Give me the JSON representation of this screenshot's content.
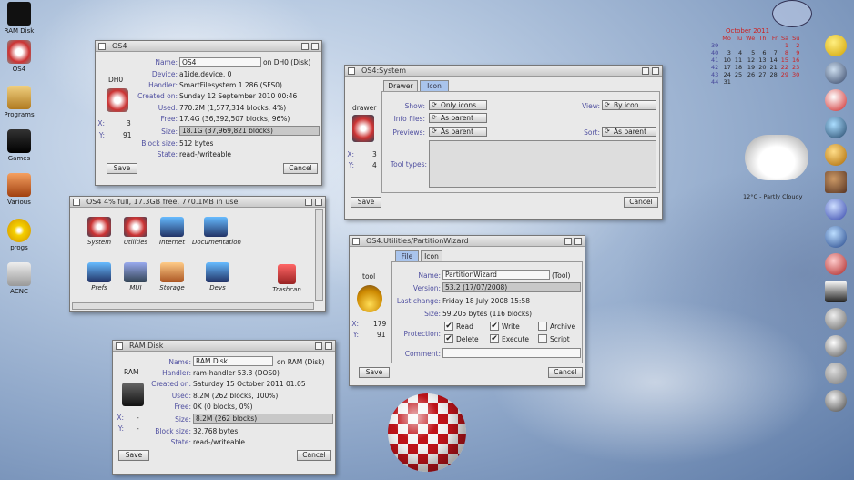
{
  "desktop_icons": [
    {
      "label": "RAM Disk"
    },
    {
      "label": "OS4"
    },
    {
      "label": "Programs"
    },
    {
      "label": "Games"
    },
    {
      "label": "Various"
    },
    {
      "label": "progs"
    },
    {
      "label": "ACNC"
    }
  ],
  "calendar": {
    "title": "October 2011",
    "days": [
      "Mo",
      "Tu",
      "We",
      "Th",
      "Fr",
      "Sa",
      "Su"
    ],
    "weeks": [
      [
        "39",
        "",
        "",
        "",
        "",
        "",
        "1",
        "2"
      ],
      [
        "40",
        "3",
        "4",
        "5",
        "6",
        "7",
        "8",
        "9"
      ],
      [
        "41",
        "10",
        "11",
        "12",
        "13",
        "14",
        "15",
        "16"
      ],
      [
        "42",
        "17",
        "18",
        "19",
        "20",
        "21",
        "22",
        "23"
      ],
      [
        "43",
        "24",
        "25",
        "26",
        "27",
        "28",
        "29",
        "30"
      ],
      [
        "44",
        "31",
        "",
        "",
        "",
        "",
        "",
        ""
      ]
    ]
  },
  "weather": {
    "text": "12°C - Partly Cloudy"
  },
  "win_os4": {
    "title": "OS4",
    "icon_label": "DH0",
    "name_label": "Name:",
    "name_value": "OS4",
    "name_suffix": "on DH0 (Disk)",
    "device_label": "Device:",
    "device_value": "a1ide.device, 0",
    "handler_label": "Handler:",
    "handler_value": "SmartFilesystem 1.286  (SFS0)",
    "created_label": "Created on:",
    "created_value": "Sunday 12 September 2010 00:46",
    "used_label": "Used:",
    "used_value": "770.2M (1,577,314 blocks, 4%)",
    "free_label": "Free:",
    "free_value": "17.4G (36,392,507 blocks, 96%)",
    "size_label": "Size:",
    "size_value": "18.1G (37,969,821 blocks)",
    "blocksize_label": "Block size:",
    "blocksize_value": "512 bytes",
    "state_label": "State:",
    "state_value": "read-/writeable",
    "x_label": "X:",
    "x_value": "3",
    "y_label": "Y:",
    "y_value": "91",
    "save": "Save",
    "cancel": "Cancel"
  },
  "win_drawer": {
    "title": "OS4  4% full, 17.3GB free, 770.1MB in use",
    "icons": [
      {
        "label": "System"
      },
      {
        "label": "Utilities"
      },
      {
        "label": "Internet"
      },
      {
        "label": "Documentation"
      },
      {
        "label": "Prefs"
      },
      {
        "label": "MUI"
      },
      {
        "label": "Storage"
      },
      {
        "label": "Devs"
      },
      {
        "label": "Trashcan"
      }
    ]
  },
  "win_system": {
    "title": "OS4:System",
    "tab_drawer": "Drawer",
    "tab_icon": "Icon",
    "icon_label": "drawer",
    "show_label": "Show:",
    "show_value": "Only icons",
    "view_label": "View:",
    "view_value": "By icon",
    "infofiles_label": "Info files:",
    "infofiles_value": "As parent",
    "previews_label": "Previews:",
    "previews_value": "As parent",
    "sort_label": "Sort:",
    "sort_value": "As parent",
    "tooltypes_label": "Tool types:",
    "x_label": "X:",
    "x_value": "3",
    "y_label": "Y:",
    "y_value": "4",
    "save": "Save",
    "cancel": "Cancel"
  },
  "win_pw": {
    "title": "OS4:Utilities/PartitionWizard",
    "tab_file": "File",
    "tab_icon": "Icon",
    "icon_label": "tool",
    "name_label": "Name:",
    "name_value": "PartitionWizard",
    "name_suffix": "(Tool)",
    "version_label": "Version:",
    "version_value": "53.2 (17/07/2008)",
    "change_label": "Last change:",
    "change_value": "Friday 18 July 2008 15:58",
    "size_label": "Size:",
    "size_value": "59,205 bytes (116 blocks)",
    "protection_label": "Protection:",
    "read": "Read",
    "write": "Write",
    "archive": "Archive",
    "delete": "Delete",
    "execute": "Execute",
    "script": "Script",
    "comment_label": "Comment:",
    "x_label": "X:",
    "x_value": "179",
    "y_label": "Y:",
    "y_value": "91",
    "save": "Save",
    "cancel": "Cancel"
  },
  "win_ram": {
    "title": "RAM Disk",
    "icon_label": "RAM",
    "name_label": "Name:",
    "name_value": "RAM Disk",
    "name_suffix": "on RAM (Disk)",
    "handler_label": "Handler:",
    "handler_value": "ram-handler 53.3  (DOS0)",
    "created_label": "Created on:",
    "created_value": "Saturday 15 October 2011 01:05",
    "used_label": "Used:",
    "used_value": "8.2M (262 blocks, 100%)",
    "free_label": "Free:",
    "free_value": "0K (0 blocks, 0%)",
    "size_label": "Size:",
    "size_value": "8.2M (262 blocks)",
    "blocksize_label": "Block size:",
    "blocksize_value": "32,768 bytes",
    "state_label": "State:",
    "state_value": "read-/writeable",
    "x_label": "X:",
    "x_value": "-",
    "y_label": "Y:",
    "y_value": "-",
    "save": "Save",
    "cancel": "Cancel"
  }
}
